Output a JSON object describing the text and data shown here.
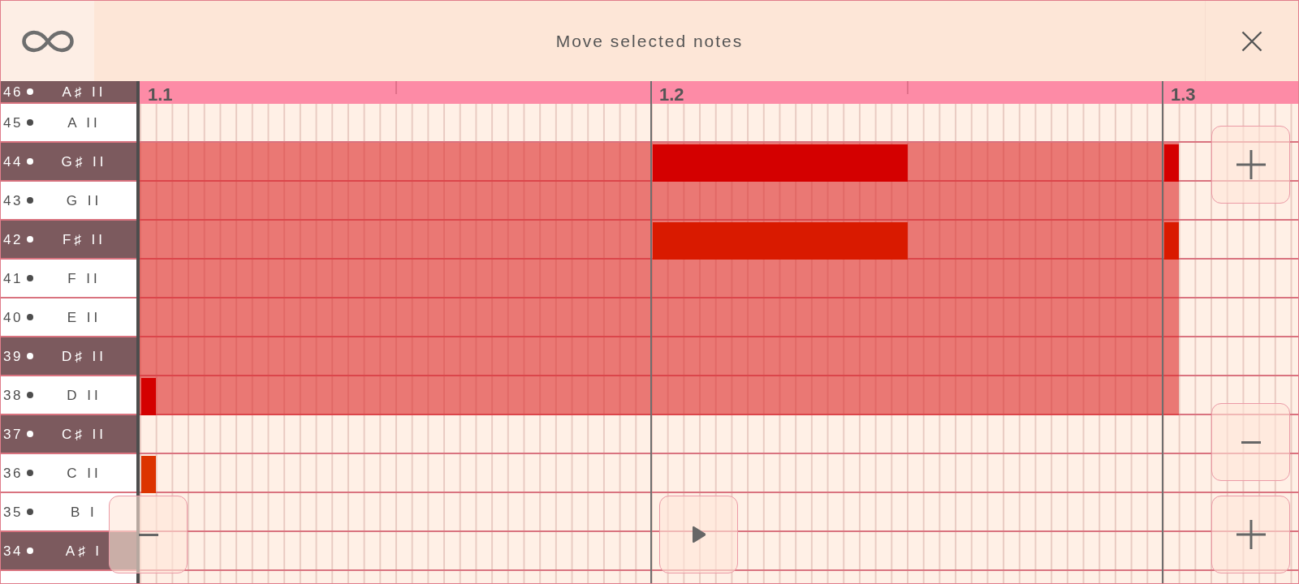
{
  "top_bar": {
    "title": "Move selected notes"
  },
  "ruler": {
    "beats": [
      {
        "label": "1.1"
      },
      {
        "label": "1.2"
      },
      {
        "label": "1.3"
      }
    ]
  },
  "keys": [
    {
      "number": "46",
      "note": "A♯ II",
      "kind": "black",
      "selected": false
    },
    {
      "number": "45",
      "note": "A II",
      "kind": "white",
      "selected": false
    },
    {
      "number": "44",
      "note": "G♯ II",
      "kind": "black",
      "selected": true,
      "beats": [
        {
          "kind": "rest"
        },
        {
          "kind": "half",
          "color": "#d40000"
        },
        {
          "kind": "step",
          "color": "#d40000"
        }
      ]
    },
    {
      "number": "43",
      "note": "G II",
      "kind": "white",
      "selected": true
    },
    {
      "number": "42",
      "note": "F♯ II",
      "kind": "black",
      "selected": true,
      "beats": [
        {
          "kind": "rest"
        },
        {
          "kind": "half",
          "color": "#d91a00"
        },
        {
          "kind": "step",
          "color": "#d91a00"
        }
      ]
    },
    {
      "number": "41",
      "note": "F II",
      "kind": "white",
      "selected": true
    },
    {
      "number": "40",
      "note": "E II",
      "kind": "white",
      "selected": true
    },
    {
      "number": "39",
      "note": "D♯ II",
      "kind": "black",
      "selected": true
    },
    {
      "number": "38",
      "note": "D II",
      "kind": "white",
      "selected": true,
      "beats": [
        {
          "kind": "step",
          "color": "#d40000"
        }
      ]
    },
    {
      "number": "37",
      "note": "C♯ II",
      "kind": "black",
      "selected": false
    },
    {
      "number": "36",
      "note": "C II",
      "kind": "white",
      "selected": false,
      "beats": [
        {
          "kind": "step",
          "color": "#dc3300"
        }
      ]
    },
    {
      "number": "35",
      "note": "B I",
      "kind": "white",
      "selected": false
    },
    {
      "number": "34",
      "note": "A♯ I",
      "kind": "black",
      "selected": false
    }
  ]
}
